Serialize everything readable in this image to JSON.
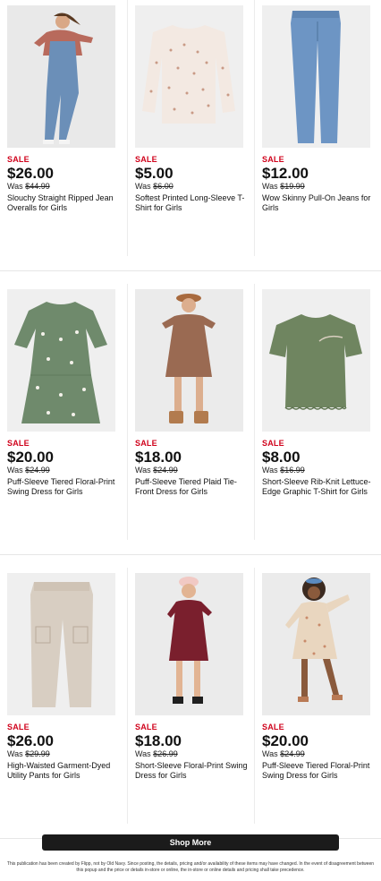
{
  "colors": {
    "sale": "#d0021b",
    "button_bg": "#1b1b1b",
    "button_text": "#ffffff"
  },
  "products": [
    {
      "badge": "SALE",
      "price": "$26.00",
      "was_label": "Was",
      "was_price": "$44.99",
      "title": "Slouchy Straight Ripped Jean Overalls for Girls",
      "image": "girl-in-denim-overalls"
    },
    {
      "badge": "SALE",
      "price": "$5.00",
      "was_label": "Was",
      "was_price": "$6.00",
      "title": "Softest Printed Long-Sleeve T-Shirt for Girls",
      "image": "printed-long-sleeve-tshirt"
    },
    {
      "badge": "SALE",
      "price": "$12.00",
      "was_label": "Was",
      "was_price": "$19.99",
      "title": "Wow Skinny Pull-On Jeans for Girls",
      "image": "skinny-jeans"
    },
    {
      "badge": "SALE",
      "price": "$20.00",
      "was_label": "Was",
      "was_price": "$24.99",
      "title": "Puff-Sleeve Tiered Floral-Print Swing Dress for Girls",
      "image": "green-floral-swing-dress"
    },
    {
      "badge": "SALE",
      "price": "$18.00",
      "was_label": "Was",
      "was_price": "$24.99",
      "title": "Puff-Sleeve Tiered Plaid Tie-Front Dress for Girls",
      "image": "girl-in-plaid-dress"
    },
    {
      "badge": "SALE",
      "price": "$8.00",
      "was_label": "Was",
      "was_price": "$16.99",
      "title": "Short-Sleeve Rib-Knit Lettuce-Edge Graphic T-Shirt for Girls",
      "image": "green-rib-knit-tshirt"
    },
    {
      "badge": "SALE",
      "price": "$26.00",
      "was_label": "Was",
      "was_price": "$29.99",
      "title": "High-Waisted Garment-Dyed Utility Pants for Girls",
      "image": "utility-pants"
    },
    {
      "badge": "SALE",
      "price": "$18.00",
      "was_label": "Was",
      "was_price": "$26.99",
      "title": "Short-Sleeve Floral-Print Swing Dress for Girls",
      "image": "girl-in-burgundy-dress"
    },
    {
      "badge": "SALE",
      "price": "$20.00",
      "was_label": "Was",
      "was_price": "$24.99",
      "title": "Puff-Sleeve Tiered Floral-Print Swing Dress for Girls",
      "image": "girl-in-floral-dress"
    }
  ],
  "cta": {
    "label": "Shop More"
  },
  "disclaimer": "This publication has been created by Flipp, not by Old Navy. Since posting, the details, pricing and/or availability of these items may have changed. In the event of disagreement between this popup and the price or details in-store or online, the in-store or online details and pricing shall take precedence."
}
